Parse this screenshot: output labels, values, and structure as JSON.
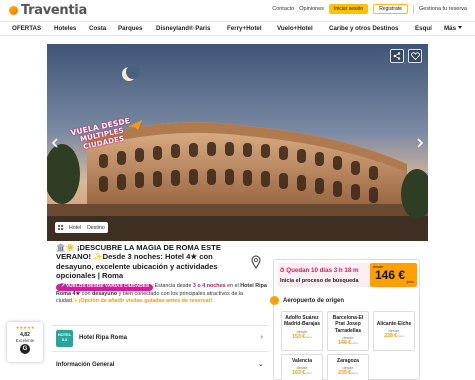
{
  "brand": {
    "name": "Traventia"
  },
  "topbar": {
    "contact": "Contacto",
    "opinions": "Opiniones",
    "login": "Iniciar sesión",
    "register": "Registrate",
    "manage": "Gestiona tu reserva"
  },
  "nav": {
    "items": [
      "OFERTAS",
      "Hoteles",
      "Costa",
      "Parques",
      "Disneyland® Paris",
      "Ferry+Hotel",
      "Vuelo+Hotel",
      "Caribe y otros Destinos",
      "Esquí",
      "Más"
    ]
  },
  "hero": {
    "badge_line1": "VUELA DESDE",
    "badge_line2": "MÚLTIPLES CIUDADES",
    "tabs": [
      "Hotel",
      "Destino"
    ]
  },
  "offer": {
    "title": "🏛️☀️ ¡DESCUBRE LA MAGIA DE ROMA ESTE VERANO! ✨Desde 3 noches: Hotel 4★ con desayuno, excelente ubicación y actividades opcionales | Roma",
    "tag": "✈️VUELOS DESDE VARIAS CIUDADES",
    "info_1": " Estancia desde ",
    "info_nights": "3 o 4 noches",
    "info_2": " en el ",
    "info_hotel": "Hotel Ripa Roma 4★",
    "info_3": " con ",
    "info_breakfast": "desayuno",
    "info_4": " y bien conectado con los principales atractivos de la ciudad",
    "info_option": "✨¡Opción de añadir visitas guiadas antes de reservar!",
    "hotel_badge": "HOTEL 8.3",
    "hotel_name": "Hotel Ripa Roma",
    "general_info": "Información General"
  },
  "rating": {
    "stars": "★★★★★",
    "score": "4,82",
    "label": "Excelente",
    "logo": "G"
  },
  "booking": {
    "countdown": "Quedan 10 días 3 h 18 m",
    "start": "Inicia el proceso de búsqueda",
    "price_from": "desde",
    "price": "146 €",
    "per": "/pers",
    "airport_title": "Aeropuerto de origen",
    "airports": [
      {
        "name": "Adolfo Suárez Madrid-Barajas",
        "from": "desde",
        "price": "153 €",
        "unit": "/pers"
      },
      {
        "name": "Barcelona-El Prat Josep Tarradellas",
        "from": "desde",
        "price": "146 €",
        "unit": "/pers"
      },
      {
        "name": "Alicante-Elche",
        "from": "desde",
        "price": "228 €",
        "unit": "/pers"
      },
      {
        "name": "Valencia",
        "from": "desde",
        "price": "163 €",
        "unit": "/pers"
      },
      {
        "name": "Zaragoza",
        "from": "desde",
        "price": "235 €",
        "unit": "/pers"
      }
    ]
  },
  "colors": {
    "accent": "#ffc107",
    "price_bg": "#ffa000",
    "countdown": "#d81b60",
    "tag": "#d81b9a"
  }
}
